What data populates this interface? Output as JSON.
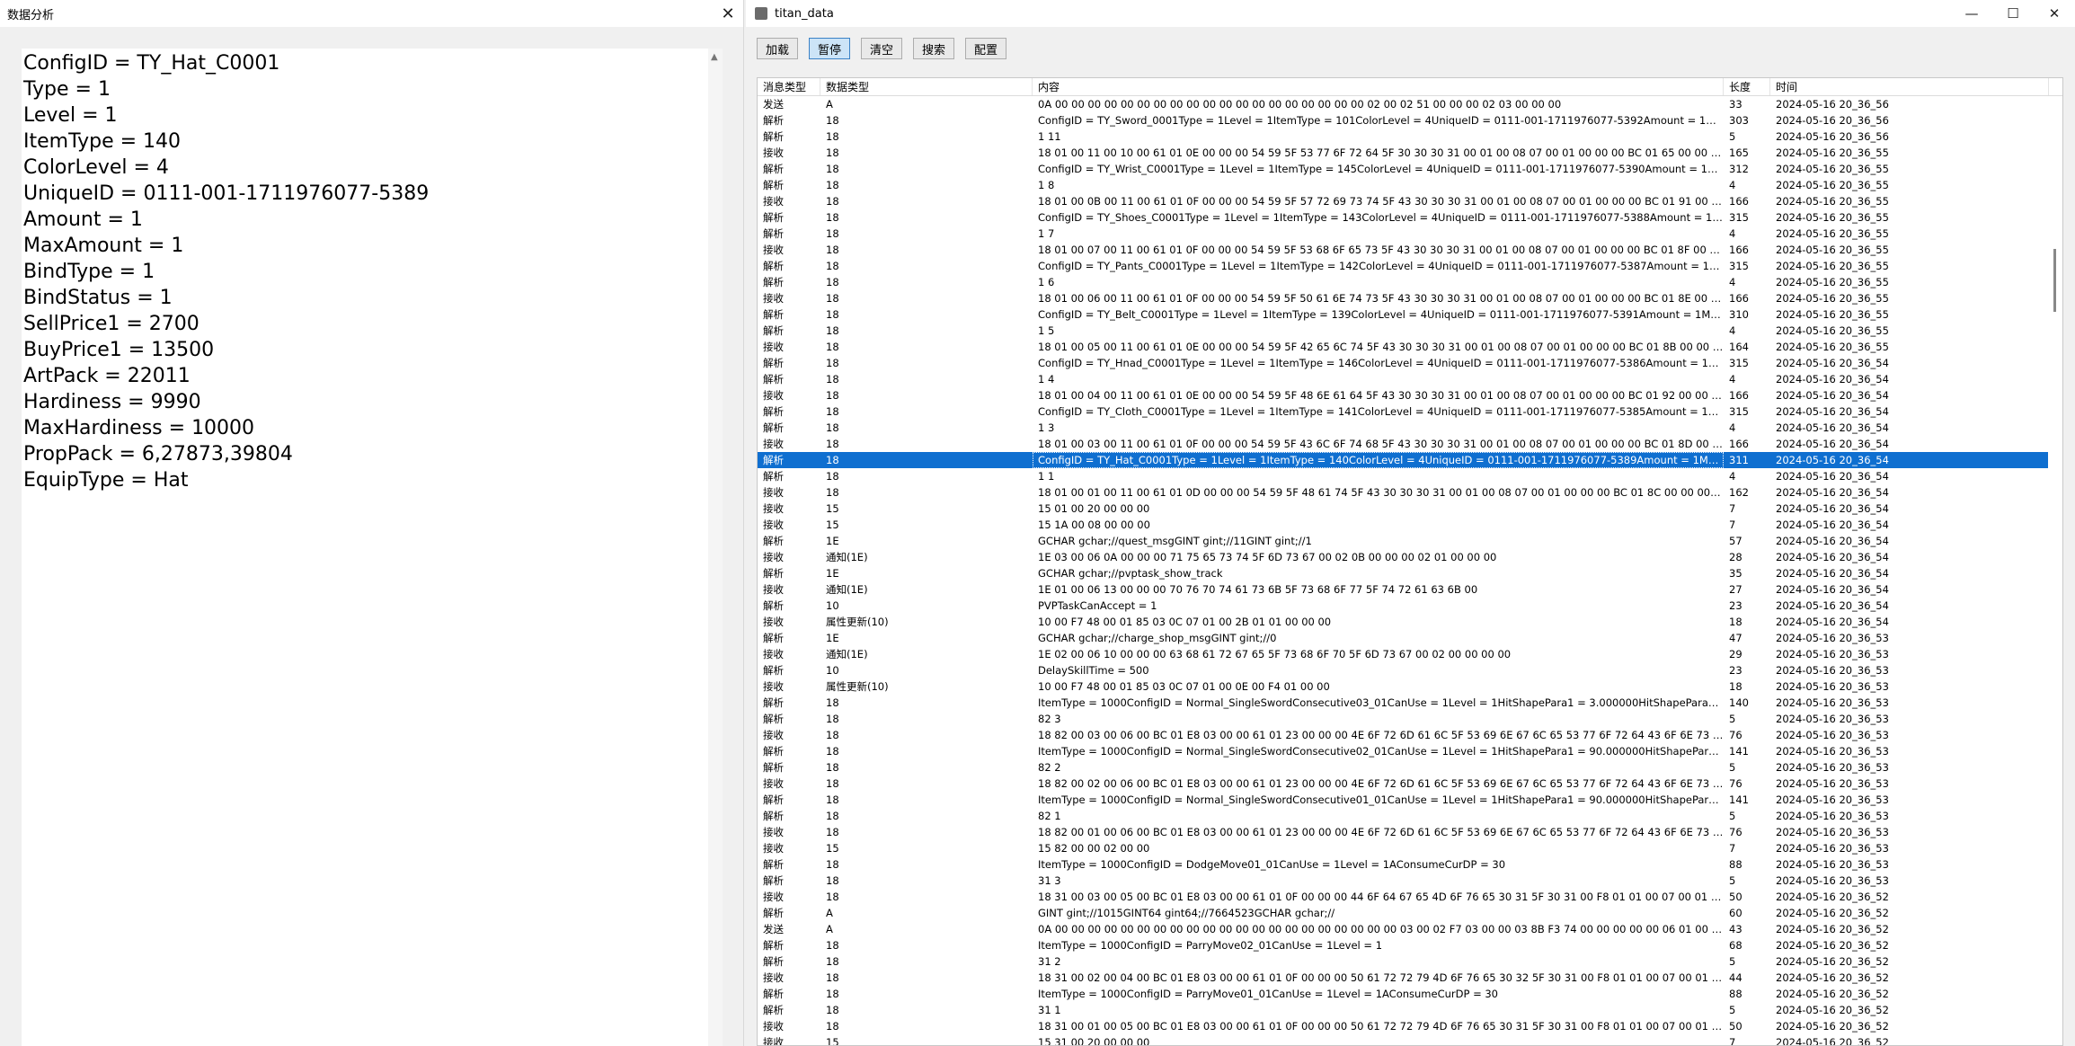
{
  "left_window": {
    "title": "数据分析",
    "close_glyph": "✕",
    "scroll_up_glyph": "▲",
    "lines": [
      "ConfigID = TY_Hat_C0001",
      "Type = 1",
      "Level = 1",
      "ItemType = 140",
      "ColorLevel = 4",
      "UniqueID = 0111-001-1711976077-5389",
      "Amount = 1",
      "MaxAmount = 1",
      "BindType = 1",
      "BindStatus = 1",
      "SellPrice1 = 2700",
      "BuyPrice1 = 13500",
      "ArtPack = 22011",
      "Hardiness = 9990",
      "MaxHardiness = 10000",
      "PropPack = 6,27873,39804",
      "EquipType = Hat"
    ]
  },
  "right_window": {
    "title": "titan_data",
    "minimize_glyph": "—",
    "maximize_glyph": "☐",
    "close_glyph": "✕",
    "toolbar": [
      "加载",
      "暂停",
      "清空",
      "搜索",
      "配置"
    ],
    "active_button_index": 1,
    "columns": [
      "消息类型",
      "数据类型",
      "内容",
      "长度",
      "时间"
    ],
    "selected_row_index": 22,
    "rows": [
      [
        "发送",
        "A",
        "0A 00 00 00 00 00 00 00 00 00 00 00 00 00 00 00 00 00 00 00 02 00 02 51 00 00 00 02 03 00 00 00",
        "33",
        "2024-05-16 20_36_56"
      ],
      [
        "解析",
        "18",
        "ConfigID = TY_Sword_0001Type = 1Level = 1ItemType = 101ColorLevel = 4UniqueID = 0111-001-1711976077-5392Amount = 1Max...",
        "303",
        "2024-05-16 20_36_56"
      ],
      [
        "解析",
        "18",
        "1 11",
        "5",
        "2024-05-16 20_36_56"
      ],
      [
        "接收",
        "18",
        "18 01 00 11 00 10 00 61 01 0E 00 00 00 54 59 5F 53 77 6F 72 64 5F 30 30 30 31 00 01 00 08 07 00 01 00 00 00 BC 01 65 00 00 0...",
        "165",
        "2024-05-16 20_36_55"
      ],
      [
        "解析",
        "18",
        "ConfigID = TY_Wrist_C0001Type = 1Level = 1ItemType = 145ColorLevel = 4UniqueID = 0111-001-1711976077-5390Amount = 1Ma...",
        "312",
        "2024-05-16 20_36_55"
      ],
      [
        "解析",
        "18",
        "1 8",
        "4",
        "2024-05-16 20_36_55"
      ],
      [
        "接收",
        "18",
        "18 01 00 0B 00 11 00 61 01 0F 00 00 00 54 59 5F 57 72 69 73 74 5F 43 30 30 30 31 00 01 00 08 07 00 01 00 00 00 BC 01 91 00 0...",
        "166",
        "2024-05-16 20_36_55"
      ],
      [
        "解析",
        "18",
        "ConfigID = TY_Shoes_C0001Type = 1Level = 1ItemType = 143ColorLevel = 4UniqueID = 0111-001-1711976077-5388Amount = 1Ma...",
        "315",
        "2024-05-16 20_36_55"
      ],
      [
        "解析",
        "18",
        "1 7",
        "4",
        "2024-05-16 20_36_55"
      ],
      [
        "接收",
        "18",
        "18 01 00 07 00 11 00 61 01 0F 00 00 00 54 59 5F 53 68 6F 65 73 5F 43 30 30 30 31 00 01 00 08 07 00 01 00 00 00 BC 01 8F 00 0...",
        "166",
        "2024-05-16 20_36_55"
      ],
      [
        "解析",
        "18",
        "ConfigID = TY_Pants_C0001Type = 1Level = 1ItemType = 142ColorLevel = 4UniqueID = 0111-001-1711976077-5387Amount = 1Ma...",
        "315",
        "2024-05-16 20_36_55"
      ],
      [
        "解析",
        "18",
        "1 6",
        "4",
        "2024-05-16 20_36_55"
      ],
      [
        "接收",
        "18",
        "18 01 00 06 00 11 00 61 01 0F 00 00 00 54 59 5F 50 61 6E 74 73 5F 43 30 30 30 31 00 01 00 08 07 00 01 00 00 00 BC 01 8E 00 0...",
        "166",
        "2024-05-16 20_36_55"
      ],
      [
        "解析",
        "18",
        "ConfigID = TY_Belt_C0001Type = 1Level = 1ItemType = 139ColorLevel = 4UniqueID = 0111-001-1711976077-5391Amount = 1Max...",
        "310",
        "2024-05-16 20_36_55"
      ],
      [
        "解析",
        "18",
        "1 5",
        "4",
        "2024-05-16 20_36_55"
      ],
      [
        "接收",
        "18",
        "18 01 00 05 00 11 00 61 01 0E 00 00 00 54 59 5F 42 65 6C 74 5F 43 30 30 30 31 00 01 00 08 07 00 01 00 00 00 BC 01 8B 00 00 0...",
        "164",
        "2024-05-16 20_36_55"
      ],
      [
        "解析",
        "18",
        "ConfigID = TY_Hnad_C0001Type = 1Level = 1ItemType = 146ColorLevel = 4UniqueID = 0111-001-1711976077-5386Amount = 1Ma...",
        "315",
        "2024-05-16 20_36_54"
      ],
      [
        "解析",
        "18",
        "1 4",
        "4",
        "2024-05-16 20_36_54"
      ],
      [
        "接收",
        "18",
        "18 01 00 04 00 11 00 61 01 0E 00 00 00 54 59 5F 48 6E 61 64 5F 43 30 30 30 31 00 01 00 08 07 00 01 00 00 00 BC 01 92 00 00 0...",
        "166",
        "2024-05-16 20_36_54"
      ],
      [
        "解析",
        "18",
        "ConfigID = TY_Cloth_C0001Type = 1Level = 1ItemType = 141ColorLevel = 4UniqueID = 0111-001-1711976077-5385Amount = 1Ma...",
        "315",
        "2024-05-16 20_36_54"
      ],
      [
        "解析",
        "18",
        "1 3",
        "4",
        "2024-05-16 20_36_54"
      ],
      [
        "接收",
        "18",
        "18 01 00 03 00 11 00 61 01 0F 00 00 00 54 59 5F 43 6C 6F 74 68 5F 43 30 30 30 31 00 01 00 08 07 00 01 00 00 00 BC 01 8D 00 0...",
        "166",
        "2024-05-16 20_36_54"
      ],
      [
        "解析",
        "18",
        "ConfigID = TY_Hat_C0001Type = 1Level = 1ItemType = 140ColorLevel = 4UniqueID = 0111-001-1711976077-5389Amount = 1MaxA...",
        "311",
        "2024-05-16 20_36_54"
      ],
      [
        "解析",
        "18",
        "1 1",
        "4",
        "2024-05-16 20_36_54"
      ],
      [
        "接收",
        "18",
        "18 01 00 01 00 11 00 61 01 0D 00 00 00 54 59 5F 48 61 74 5F 43 30 30 30 31 00 01 00 08 07 00 01 00 00 00 BC 01 8C 00 00 00 B...",
        "162",
        "2024-05-16 20_36_54"
      ],
      [
        "接收",
        "15",
        "15 01 00 20 00 00 00",
        "7",
        "2024-05-16 20_36_54"
      ],
      [
        "接收",
        "15",
        "15 1A 00 08 00 00 00",
        "7",
        "2024-05-16 20_36_54"
      ],
      [
        "解析",
        "1E",
        "GCHAR gchar;//quest_msgGINT gint;//11GINT gint;//1",
        "57",
        "2024-05-16 20_36_54"
      ],
      [
        "接收",
        "通知(1E)",
        "1E 03 00 06 0A 00 00 00 71 75 65 73 74 5F 6D 73 67 00 02 0B 00 00 00 02 01 00 00 00",
        "28",
        "2024-05-16 20_36_54"
      ],
      [
        "解析",
        "1E",
        "GCHAR gchar;//pvptask_show_track",
        "35",
        "2024-05-16 20_36_54"
      ],
      [
        "接收",
        "通知(1E)",
        "1E 01 00 06 13 00 00 00 70 76 70 74 61 73 6B 5F 73 68 6F 77 5F 74 72 61 63 6B 00",
        "27",
        "2024-05-16 20_36_54"
      ],
      [
        "解析",
        "10",
        "PVPTaskCanAccept = 1",
        "23",
        "2024-05-16 20_36_54"
      ],
      [
        "接收",
        "属性更新(10)",
        "10 00 F7 48 00 01 85 03 0C 07 01 00 2B 01 01 00 00 00",
        "18",
        "2024-05-16 20_36_54"
      ],
      [
        "解析",
        "1E",
        "GCHAR gchar;//charge_shop_msgGINT gint;//0",
        "47",
        "2024-05-16 20_36_53"
      ],
      [
        "接收",
        "通知(1E)",
        "1E 02 00 06 10 00 00 00 63 68 61 72 67 65 5F 73 68 6F 70 5F 6D 73 67 00 02 00 00 00 00",
        "29",
        "2024-05-16 20_36_53"
      ],
      [
        "解析",
        "10",
        "DelaySkillTime = 500",
        "23",
        "2024-05-16 20_36_53"
      ],
      [
        "接收",
        "属性更新(10)",
        "10 00 F7 48 00 01 85 03 0C 07 01 00 0E 00 F4 01 00 00",
        "18",
        "2024-05-16 20_36_53"
      ],
      [
        "解析",
        "18",
        "ItemType = 1000ConfigID = Normal_SingleSwordConsecutive03_01CanUse = 1Level = 1HitShapePara1 = 3.000000HitShapePara2 = 8....",
        "140",
        "2024-05-16 20_36_53"
      ],
      [
        "解析",
        "18",
        "82 3",
        "5",
        "2024-05-16 20_36_53"
      ],
      [
        "接收",
        "18",
        "18 82 00 03 00 06 00 BC 01 E8 03 00 00 61 01 23 00 00 00 4E 6F 72 6D 61 6C 5F 53 69 6E 67 6C 65 53 77 6F 72 64 43 6F 6E 73 6...",
        "76",
        "2024-05-16 20_36_53"
      ],
      [
        "解析",
        "18",
        "ItemType = 1000ConfigID = Normal_SingleSwordConsecutive02_01CanUse = 1Level = 1HitShapePara1 = 90.000000HitShapePara2 = ...",
        "141",
        "2024-05-16 20_36_53"
      ],
      [
        "解析",
        "18",
        "82 2",
        "5",
        "2024-05-16 20_36_53"
      ],
      [
        "接收",
        "18",
        "18 82 00 02 00 06 00 BC 01 E8 03 00 00 61 01 23 00 00 00 4E 6F 72 6D 61 6C 5F 53 69 6E 67 6C 65 53 77 6F 72 64 43 6F 6E 73 6...",
        "76",
        "2024-05-16 20_36_53"
      ],
      [
        "解析",
        "18",
        "ItemType = 1000ConfigID = Normal_SingleSwordConsecutive01_01CanUse = 1Level = 1HitShapePara1 = 90.000000HitShapePara2 = ...",
        "141",
        "2024-05-16 20_36_53"
      ],
      [
        "解析",
        "18",
        "82 1",
        "5",
        "2024-05-16 20_36_53"
      ],
      [
        "接收",
        "18",
        "18 82 00 01 00 06 00 BC 01 E8 03 00 00 61 01 23 00 00 00 4E 6F 72 6D 61 6C 5F 53 69 6E 67 6C 65 53 77 6F 72 64 43 6F 6E 73 6...",
        "76",
        "2024-05-16 20_36_53"
      ],
      [
        "接收",
        "15",
        "15 82 00 00 02 00 00",
        "7",
        "2024-05-16 20_36_53"
      ],
      [
        "解析",
        "18",
        "ItemType = 1000ConfigID = DodgeMove01_01CanUse = 1Level = 1AConsumeCurDP = 30",
        "88",
        "2024-05-16 20_36_53"
      ],
      [
        "解析",
        "18",
        "31 3",
        "5",
        "2024-05-16 20_36_53"
      ],
      [
        "接收",
        "18",
        "18 31 00 03 00 05 00 BC 01 E8 03 00 00 61 01 0F 00 00 00 44 6F 64 67 65 4D 6F 76 65 30 31 5F 30 31 00 F8 01 01 00 07 00 01 0...",
        "50",
        "2024-05-16 20_36_52"
      ],
      [
        "解析",
        "A",
        "GINT gint;//1015GINT64 gint64;//7664523GCHAR gchar;//",
        "60",
        "2024-05-16 20_36_52"
      ],
      [
        "发送",
        "A",
        "0A 00 00 00 00 00 00 00 00 00 00 00 00 00 00 00 00 00 00 00 00 00 03 00 02 F7 03 00 00 03 8B F3 74 00 00 00 00 00 06 01 00 00 0...",
        "43",
        "2024-05-16 20_36_52"
      ],
      [
        "解析",
        "18",
        "ItemType = 1000ConfigID = ParryMove02_01CanUse = 1Level = 1",
        "68",
        "2024-05-16 20_36_52"
      ],
      [
        "解析",
        "18",
        "31 2",
        "5",
        "2024-05-16 20_36_52"
      ],
      [
        "接收",
        "18",
        "18 31 00 02 00 04 00 BC 01 E8 03 00 00 61 01 0F 00 00 00 50 61 72 72 79 4D 6F 76 65 30 32 5F 30 31 00 F8 01 01 00 07 00 01 0...",
        "44",
        "2024-05-16 20_36_52"
      ],
      [
        "解析",
        "18",
        "ItemType = 1000ConfigID = ParryMove01_01CanUse = 1Level = 1AConsumeCurDP = 30",
        "88",
        "2024-05-16 20_36_52"
      ],
      [
        "解析",
        "18",
        "31 1",
        "5",
        "2024-05-16 20_36_52"
      ],
      [
        "接收",
        "18",
        "18 31 00 01 00 05 00 BC 01 E8 03 00 00 61 01 0F 00 00 00 50 61 72 72 79 4D 6F 76 65 30 31 5F 30 31 00 F8 01 01 00 07 00 01 0...",
        "50",
        "2024-05-16 20_36_52"
      ],
      [
        "接收",
        "15",
        "15 31 00 20 00 00 00",
        "7",
        "2024-05-16 20_36_52"
      ]
    ]
  }
}
